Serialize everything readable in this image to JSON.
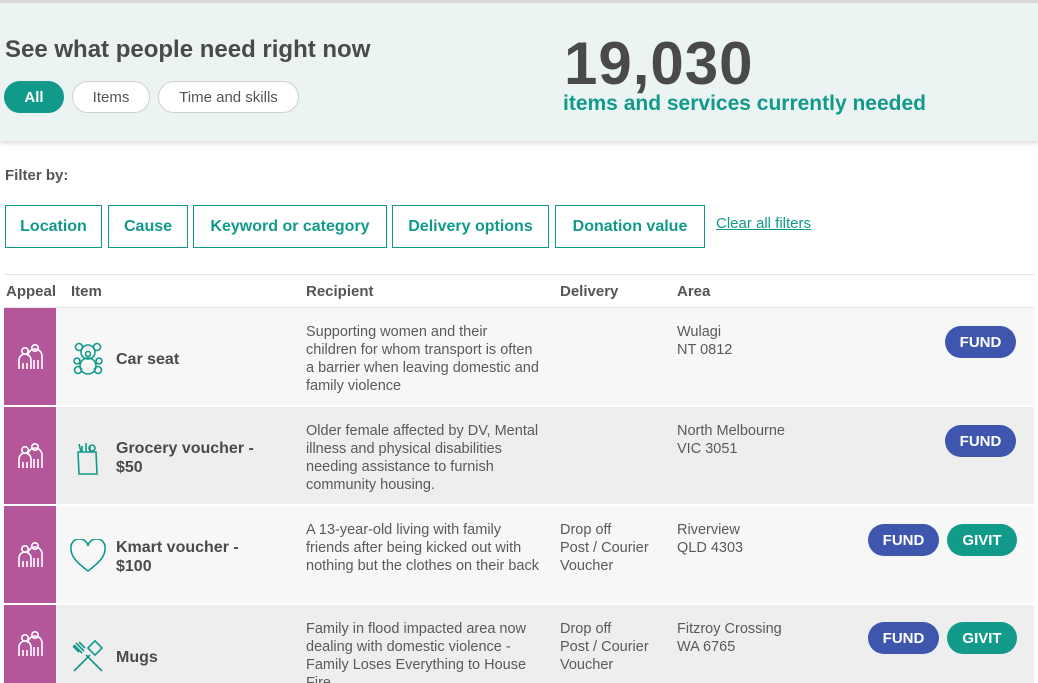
{
  "hero": {
    "title": "See what people need right now",
    "tabs": [
      "All",
      "Items",
      "Time and skills"
    ],
    "count": "19,030",
    "count_caption": "items and services currently needed"
  },
  "filters": {
    "label": "Filter by:",
    "buttons": [
      "Location",
      "Cause",
      "Keyword or category",
      "Delivery options",
      "Donation value"
    ],
    "clear": "Clear all filters"
  },
  "table": {
    "headers": [
      "Appeal",
      "Item",
      "Recipient",
      "Delivery",
      "Area"
    ],
    "rows": [
      {
        "item_line1": "Car seat",
        "item_line2": "",
        "icon": "teddy-bear-icon",
        "recipient": "Supporting women and their children for whom transport is often a barrier when leaving domestic and family violence",
        "delivery": [],
        "area_line1": "Wulagi",
        "area_line2": "NT 0812",
        "fund": "FUND"
      },
      {
        "item_line1": "Grocery voucher -",
        "item_line2": "$50",
        "icon": "grocery-bag-icon",
        "recipient": "Older female affected by DV, Mental illness and physical disabilities needing assistance to furnish community housing.",
        "delivery": [],
        "area_line1": "North Melbourne",
        "area_line2": "VIC 3051",
        "fund": "FUND"
      },
      {
        "item_line1": "Kmart voucher -",
        "item_line2": "$100",
        "icon": "heart-icon",
        "recipient": "A 13-year-old living with family friends after being kicked out with nothing but the clothes on their back",
        "delivery": [
          "Drop off",
          "Post / Courier",
          "Voucher"
        ],
        "area_line1": "Riverview",
        "area_line2": "QLD 4303",
        "fund": "FUND",
        "givit": "GIVIT"
      },
      {
        "item_line1": "Mugs",
        "item_line2": "",
        "icon": "kitchen-utensils-icon",
        "recipient": "Family in flood impacted area now dealing with domestic violence - Family Loses Everything to House Fire",
        "delivery": [
          "Drop off",
          "Post / Courier",
          "Voucher"
        ],
        "area_line1": "Fitzroy Crossing",
        "area_line2": "WA 6765",
        "fund": "FUND",
        "givit": "GIVIT"
      }
    ]
  },
  "colors": {
    "teal": "#119a8a",
    "fund_blue": "#3e56ae",
    "appeal_purple": "#b4569a"
  }
}
